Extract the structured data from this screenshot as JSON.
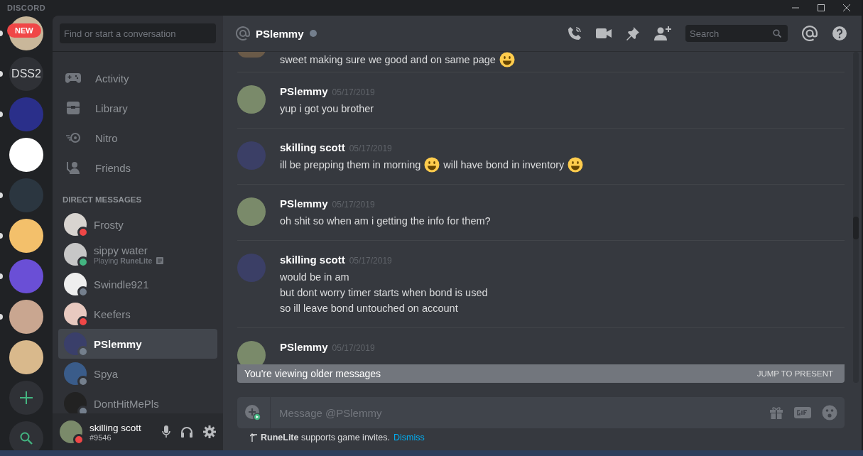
{
  "app_name": "DISCORD",
  "servers": [
    {
      "kind": "image",
      "unread": true,
      "badge": "NEW"
    },
    {
      "kind": "text",
      "unread": true,
      "label": "DSS2"
    },
    {
      "kind": "image",
      "unread": true
    },
    {
      "kind": "image",
      "unread": false
    },
    {
      "kind": "image",
      "unread": true
    },
    {
      "kind": "image",
      "unread": true
    },
    {
      "kind": "image",
      "unread": true
    },
    {
      "kind": "image",
      "unread": true
    },
    {
      "kind": "image",
      "unread": false
    }
  ],
  "search": {
    "placeholder": "Find or start a conversation"
  },
  "nav": [
    {
      "kind": "activity",
      "label": "Activity"
    },
    {
      "kind": "library",
      "label": "Library"
    },
    {
      "kind": "nitro",
      "label": "Nitro"
    },
    {
      "kind": "friends",
      "label": "Friends"
    }
  ],
  "dm_heading": "DIRECT MESSAGES",
  "dms": [
    {
      "name": "Frosty",
      "color": "#f04747",
      "selected": false
    },
    {
      "name": "sippy water",
      "color": "#43b581",
      "activity": "Playing **RuneLite**",
      "selected": false
    },
    {
      "name": "Swindle921",
      "color": "#747f8d",
      "selected": false
    },
    {
      "name": "Keefers",
      "color": "#f04747",
      "selected": false
    },
    {
      "name": "PSlemmy",
      "color": "#747f8d",
      "selected": true
    },
    {
      "name": "Spya",
      "color": "#747f8d",
      "selected": false
    },
    {
      "name": "DontHitMePls",
      "color": "#747f8d",
      "selected": false
    }
  ],
  "user": {
    "name": "skilling scott",
    "tag": "#9546",
    "color": "#f04747"
  },
  "chat_header": {
    "name": "PSlemmy",
    "color": "#747f8d",
    "search_placeholder": "Search"
  },
  "messages": [
    {
      "kind": "partial",
      "lines": [
        [
          {
            "kind": "text",
            "text": "sweet making sure we good and on same page"
          },
          {
            "kind": "emoji"
          }
        ]
      ]
    },
    {
      "kind": "group",
      "author": "PSlemmy",
      "time": "05/17/2019",
      "lines": [
        [
          {
            "kind": "text",
            "text": "yup i got you brother"
          }
        ]
      ]
    },
    {
      "kind": "group",
      "author": "skilling scott",
      "time": "05/17/2019",
      "lines": [
        [
          {
            "kind": "text",
            "text": "ill be prepping them in morning"
          },
          {
            "kind": "emoji"
          },
          {
            "kind": "text",
            "text": "will have bond in inventory"
          },
          {
            "kind": "emoji"
          }
        ]
      ]
    },
    {
      "kind": "group",
      "author": "PSlemmy",
      "time": "05/17/2019",
      "lines": [
        [
          {
            "kind": "text",
            "text": "oh shit so when am i getting the info for them?"
          }
        ]
      ]
    },
    {
      "kind": "group",
      "author": "skilling scott",
      "time": "05/17/2019",
      "lines": [
        [
          {
            "kind": "text",
            "text": "would be in am"
          }
        ],
        [
          {
            "kind": "text",
            "text": "but dont worry timer starts when bond is used"
          }
        ],
        [
          {
            "kind": "text",
            "text": "so ill leave bond untouched on account"
          }
        ]
      ]
    },
    {
      "kind": "group",
      "author": "PSlemmy",
      "time": "05/17/2019"
    }
  ],
  "banner": {
    "text": "You're viewing older messages",
    "action": "JUMP TO PRESENT"
  },
  "composer": {
    "placeholder": "Message @PSlemmy"
  },
  "notice": {
    "text": "**RuneLite** supports game invites.",
    "link": "Dismiss"
  }
}
